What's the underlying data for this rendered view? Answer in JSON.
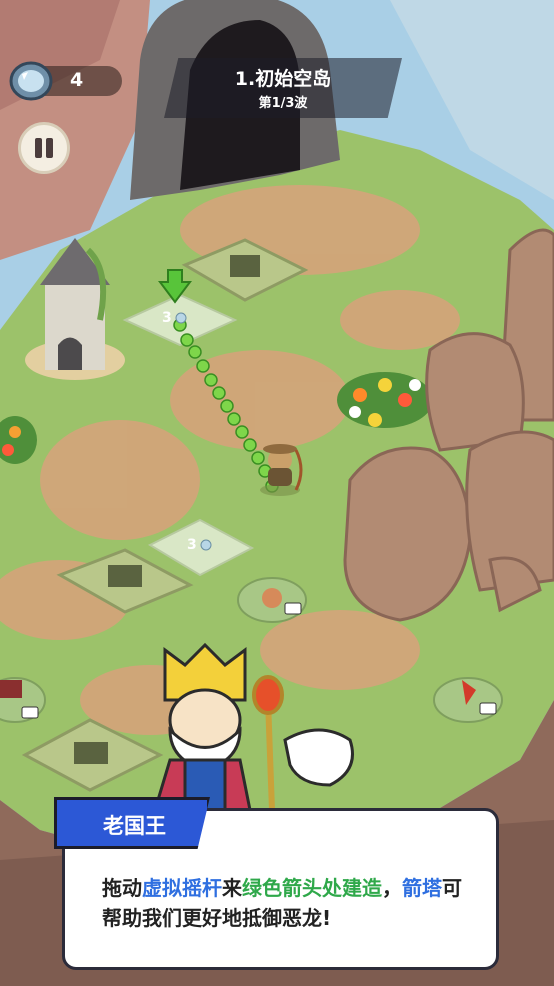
{
  "hud": {
    "gem_count": "4",
    "level_title": "1.初始空岛",
    "wave_label": "第1/3波"
  },
  "build_slots": [
    {
      "cost": "3"
    },
    {
      "cost": "3"
    }
  ],
  "dialog": {
    "speaker": "老国王",
    "segments": [
      {
        "text": "拖动",
        "style": "normal"
      },
      {
        "text": "虚拟摇杆",
        "style": "blue"
      },
      {
        "text": "来",
        "style": "normal"
      },
      {
        "text": "绿色箭头处建造",
        "style": "green"
      },
      {
        "text": "，",
        "style": "normal"
      },
      {
        "text": "箭塔",
        "style": "blue"
      },
      {
        "text": "可帮助我们更好地抵御恶龙!",
        "style": "normal"
      }
    ]
  },
  "colors": {
    "grass": "#9cc26a",
    "dirt": "#d8a27b",
    "rock": "#b28b73",
    "highlight_blue": "#2f6fe0",
    "highlight_green": "#2fa84a",
    "dialog_tag": "#2c58d6"
  }
}
